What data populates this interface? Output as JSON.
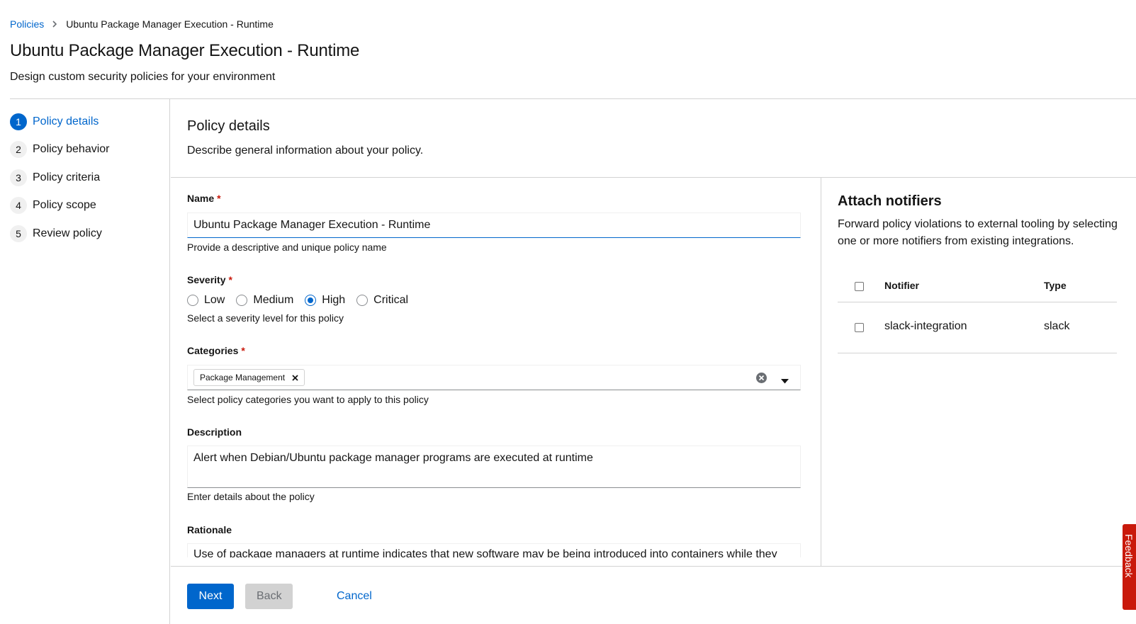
{
  "breadcrumb": {
    "root": "Policies",
    "current": "Ubuntu Package Manager Execution - Runtime"
  },
  "header": {
    "title": "Ubuntu Package Manager Execution - Runtime",
    "subtitle": "Design custom security policies for your environment"
  },
  "wizard": {
    "steps": [
      {
        "num": "1",
        "label": "Policy details",
        "active": true
      },
      {
        "num": "2",
        "label": "Policy behavior"
      },
      {
        "num": "3",
        "label": "Policy criteria"
      },
      {
        "num": "4",
        "label": "Policy scope"
      },
      {
        "num": "5",
        "label": "Review policy"
      }
    ]
  },
  "details": {
    "title": "Policy details",
    "description": "Describe general information about your policy."
  },
  "form": {
    "name": {
      "label": "Name",
      "required": "*",
      "value": "Ubuntu Package Manager Execution - Runtime",
      "helper": "Provide a descriptive and unique policy name"
    },
    "severity": {
      "label": "Severity",
      "required": "*",
      "options": [
        "Low",
        "Medium",
        "High",
        "Critical"
      ],
      "selected": "High",
      "helper": "Select a severity level for this policy"
    },
    "categories": {
      "label": "Categories",
      "required": "*",
      "chip": "Package Management",
      "helper": "Select policy categories you want to apply to this policy"
    },
    "description": {
      "label": "Description",
      "value": "Alert when Debian/Ubuntu package manager programs are executed at runtime",
      "helper": "Enter details about the policy"
    },
    "rationale": {
      "label": "Rationale",
      "value": "Use of package managers at runtime indicates that new software may be being introduced into containers while they are running."
    }
  },
  "notifiers": {
    "title": "Attach notifiers",
    "description": "Forward policy violations to external tooling by selecting one or more notifiers from existing integrations.",
    "columns": {
      "notifier": "Notifier",
      "type": "Type"
    },
    "rows": [
      {
        "notifier": "slack-integration",
        "type": "slack"
      }
    ]
  },
  "footer": {
    "next": "Next",
    "back": "Back",
    "cancel": "Cancel"
  },
  "feedback": {
    "label": "Feedback"
  },
  "colors": {
    "primary": "#0066cc",
    "required": "#c9190b",
    "feedback": "#c9190b"
  }
}
